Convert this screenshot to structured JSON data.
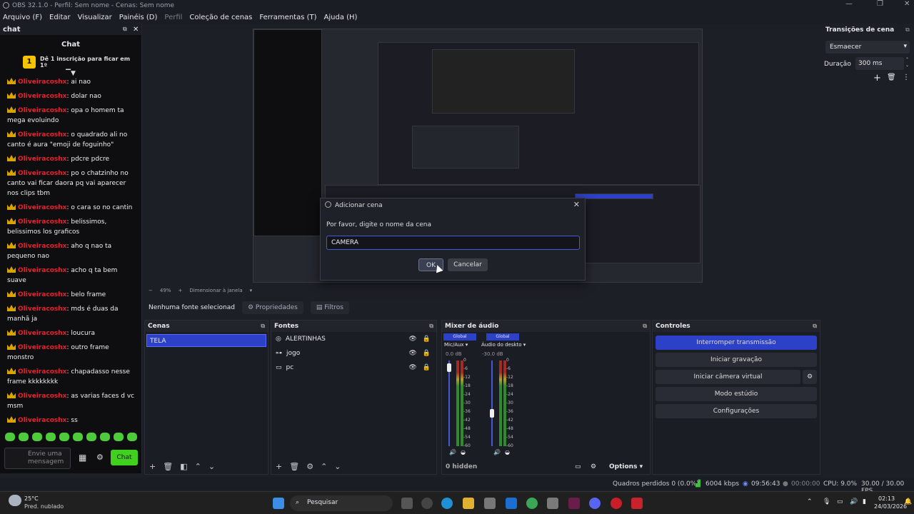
{
  "window": {
    "title": "OBS 32.1.0 - Perfil: Sem nome - Cenas: Sem nome"
  },
  "menu": [
    "Arquivo (F)",
    "Editar",
    "Visualizar",
    "Painéis (D)",
    "Perfil",
    "Coleção de cenas",
    "Ferramentas (T)",
    "Ajuda (H)"
  ],
  "chat": {
    "dock_title": "chat",
    "title": "Chat",
    "sub_badge": "1",
    "sub_text": "Dê 1 inscrição para ficar em 1º",
    "messages": [
      {
        "user": "Oliveiracoshx",
        "text": ": ai nao"
      },
      {
        "user": "Oliveiracoshx",
        "text": ": dolar nao"
      },
      {
        "user": "Oliveiracoshx",
        "text": ": opa o homem ta mega evoluindo"
      },
      {
        "user": "Oliveiracoshx",
        "text": ": o quadrado ali no canto é aura \"emoji de foguinho\""
      },
      {
        "user": "Oliveiracoshx",
        "text": ": pdcre pdcre"
      },
      {
        "user": "Oliveiracoshx",
        "text": ": po o chatzinho no canto vai ficar daora pq vai aparecer nos clips tbm"
      },
      {
        "user": "Oliveiracoshx",
        "text": ": o cara so no cantin"
      },
      {
        "user": "Oliveiracoshx",
        "text": ": belissimos, belissimos los graficos"
      },
      {
        "user": "Oliveiracoshx",
        "text": ": aho q nao ta pequeno nao"
      },
      {
        "user": "Oliveiracoshx",
        "text": ": acho q ta bem suave"
      },
      {
        "user": "Oliveiracoshx",
        "text": ": belo frame"
      },
      {
        "user": "Oliveiracoshx",
        "text": ": mds é duas da manhã ja"
      },
      {
        "user": "Oliveiracoshx",
        "text": ": loucura"
      },
      {
        "user": "Oliveiracoshx",
        "text": ": outro frame monstro"
      },
      {
        "user": "Oliveiracoshx",
        "text": ": chapadasso nesse frame kkkkkkkk"
      },
      {
        "user": "Oliveiracoshx",
        "text": ": as varias faces d vc msm"
      },
      {
        "user": "Oliveiracoshx",
        "text": ": ss"
      }
    ],
    "input_placeholder": "Envie uma mensagem",
    "send_label": "Chat"
  },
  "preview": {
    "zoom": "49%",
    "zoom_mode": "Dimensionar à janela"
  },
  "dialog": {
    "title": "Adicionar cena",
    "prompt": "Por favor, digite o nome da cena",
    "value": "CAMERA",
    "ok": "OK",
    "cancel": "Cancelar"
  },
  "context": {
    "no_source": "Nenhuma fonte selecionad",
    "properties": "Propriedades",
    "filters": "Filtros"
  },
  "scenes": {
    "title": "Cenas",
    "items": [
      "TELA"
    ]
  },
  "sources": {
    "title": "Fontes",
    "items": [
      "ALERTINHAS",
      "jogo",
      "pc"
    ]
  },
  "mixer": {
    "title": "Mixer de áudio",
    "channels": [
      {
        "scope": "Global",
        "name": "Mic/Aux",
        "db": "0.0 dB",
        "level": 0.92
      },
      {
        "scope": "Global",
        "name": "Áudio do deskto",
        "db": "-30.0 dB",
        "level": 0.38
      }
    ],
    "scale": [
      "0",
      "-6",
      "-12",
      "-18",
      "-24",
      "-30",
      "-36",
      "-42",
      "-48",
      "-54",
      "-60"
    ],
    "hidden": "0 hidden",
    "options": "Options"
  },
  "controls": {
    "title": "Controles",
    "buttons": [
      "Interromper transmissão",
      "Iniciar gravação",
      "Iniciar câmera virtual",
      "Modo estúdio",
      "Configurações"
    ]
  },
  "transitions": {
    "title": "Transições de cena",
    "selected": "Esmaecer",
    "duration_label": "Duração",
    "duration": "300 ms"
  },
  "status": {
    "dropped": "Quadros perdidos 0 (0.0%)",
    "bitrate": "6004 kbps",
    "stream_time": "09:56:43",
    "rec_time": "00:00:00",
    "cpu": "CPU: 9.0%",
    "fps": "30.00 / 30.00 FPS"
  },
  "taskbar": {
    "temp": "25°C",
    "weather": "Pred. nublado",
    "search": "Pesquisar",
    "time": "02:13",
    "date": "24/03/2026"
  },
  "colors": {
    "accent": "#2d41c8",
    "chat_user": "#e8212e",
    "chat_send": "#3fd11e"
  }
}
